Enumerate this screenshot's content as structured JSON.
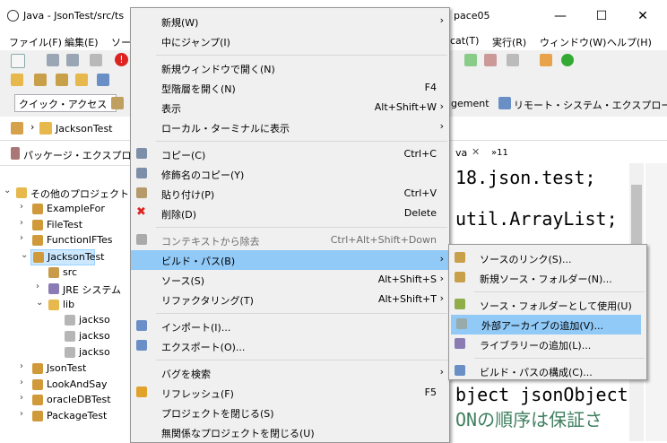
{
  "window": {
    "title": "Java - JsonTest/src/ts",
    "title_right": "pace05",
    "minimize": "—",
    "maximize": "☐",
    "close": "✕"
  },
  "menubar": {
    "items": [
      "ファイル(F)",
      "編集(E)",
      "ソー"
    ],
    "items_right": [
      "cat(T)",
      "実行(R)",
      "ウィンドウ(W)",
      "ヘルプ(H)"
    ]
  },
  "toolbar": {
    "quick_access": "クイック・アクセス",
    "right_text_1": "gement",
    "right_text_2": "リモート・システム・エクスプローラー"
  },
  "breadcrumb": {
    "item": "JacksonTest"
  },
  "package_explorer": {
    "tab_label": "パッケージ・エクスプローラ",
    "tree": [
      {
        "label": "その他のプロジェクト",
        "indent": 0,
        "expanded": true,
        "icon": "folder-icon"
      },
      {
        "label": "ExampleFor",
        "indent": 1,
        "icon": "project-icon"
      },
      {
        "label": "FileTest",
        "indent": 1,
        "icon": "project-icon"
      },
      {
        "label": "FunctionIFTes",
        "indent": 1,
        "icon": "project-icon"
      },
      {
        "label": "JacksonTest",
        "indent": 1,
        "expanded": true,
        "selected": true,
        "icon": "project-icon"
      },
      {
        "label": "src",
        "indent": 2,
        "icon": "package-folder-icon"
      },
      {
        "label": "JRE システム",
        "indent": 2,
        "icon": "library-icon"
      },
      {
        "label": "lib",
        "indent": 2,
        "expanded": true,
        "icon": "folder-icon"
      },
      {
        "label": "jackso",
        "indent": 3,
        "icon": "jar-icon"
      },
      {
        "label": "jackso",
        "indent": 3,
        "icon": "jar-icon"
      },
      {
        "label": "jackso",
        "indent": 3,
        "icon": "jar-icon"
      },
      {
        "label": "JsonTest",
        "indent": 1,
        "icon": "project-icon"
      },
      {
        "label": "LookAndSay",
        "indent": 1,
        "icon": "project-icon"
      },
      {
        "label": "oracleDBTest",
        "indent": 1,
        "icon": "project-icon"
      },
      {
        "label": "PackageTest",
        "indent": 1,
        "icon": "project-icon"
      }
    ]
  },
  "editor": {
    "tab_label": "va",
    "tab_overflow": "»11",
    "lines": [
      "18.json.test;",
      "util.ArrayList;",
      "bject jsonObject",
      "ONの順序は保証さ"
    ]
  },
  "context_menu": {
    "items": [
      {
        "label": "新規(W)",
        "submenu": true
      },
      {
        "label": "中にジャンプ(I)"
      },
      {
        "sep": true
      },
      {
        "label": "新規ウィンドウで開く(N)"
      },
      {
        "label": "型階層を開く(N)",
        "shortcut": "F4"
      },
      {
        "label": "表示",
        "shortcut": "Alt+Shift+W",
        "submenu": true
      },
      {
        "label": "ローカル・ターミナルに表示",
        "submenu": true
      },
      {
        "sep": true
      },
      {
        "label": "コピー(C)",
        "shortcut": "Ctrl+C",
        "icon": "copy-icon"
      },
      {
        "label": "修飾名のコピー(Y)",
        "icon": "copy-qualified-icon"
      },
      {
        "label": "貼り付け(P)",
        "shortcut": "Ctrl+V",
        "icon": "paste-icon"
      },
      {
        "label": "削除(D)",
        "shortcut": "Delete",
        "icon": "delete-icon"
      },
      {
        "sep": true
      },
      {
        "label": "コンテキストから除去",
        "shortcut": "Ctrl+Alt+Shift+Down",
        "disabled": true,
        "icon": "remove-context-icon"
      },
      {
        "label": "ビルド・パス(B)",
        "submenu": true,
        "highlighted": true
      },
      {
        "label": "ソース(S)",
        "shortcut": "Alt+Shift+S",
        "submenu": true
      },
      {
        "label": "リファクタリング(T)",
        "shortcut": "Alt+Shift+T",
        "submenu": true
      },
      {
        "sep": true
      },
      {
        "label": "インポート(I)...",
        "icon": "import-icon"
      },
      {
        "label": "エクスポート(O)...",
        "icon": "export-icon"
      },
      {
        "sep": true
      },
      {
        "label": "バグを検索",
        "submenu": true
      },
      {
        "label": "リフレッシュ(F)",
        "shortcut": "F5",
        "icon": "refresh-icon"
      },
      {
        "label": "プロジェクトを閉じる(S)"
      },
      {
        "label": "無関係なプロジェクトを閉じる(U)"
      }
    ]
  },
  "build_path_submenu": {
    "items": [
      {
        "label": "ソースのリンク(S)...",
        "icon": "link-source-icon"
      },
      {
        "label": "新規ソース・フォルダー(N)...",
        "icon": "new-source-folder-icon"
      },
      {
        "sep": true
      },
      {
        "label": "ソース・フォルダーとして使用(U)",
        "icon": "use-as-source-icon"
      },
      {
        "label": "外部アーカイブの追加(V)...",
        "icon": "add-external-archive-icon",
        "highlighted": true
      },
      {
        "label": "ライブラリーの追加(L)...",
        "icon": "add-library-icon"
      },
      {
        "sep": true
      },
      {
        "label": "ビルド・パスの構成(C)...",
        "icon": "configure-build-path-icon"
      }
    ]
  }
}
